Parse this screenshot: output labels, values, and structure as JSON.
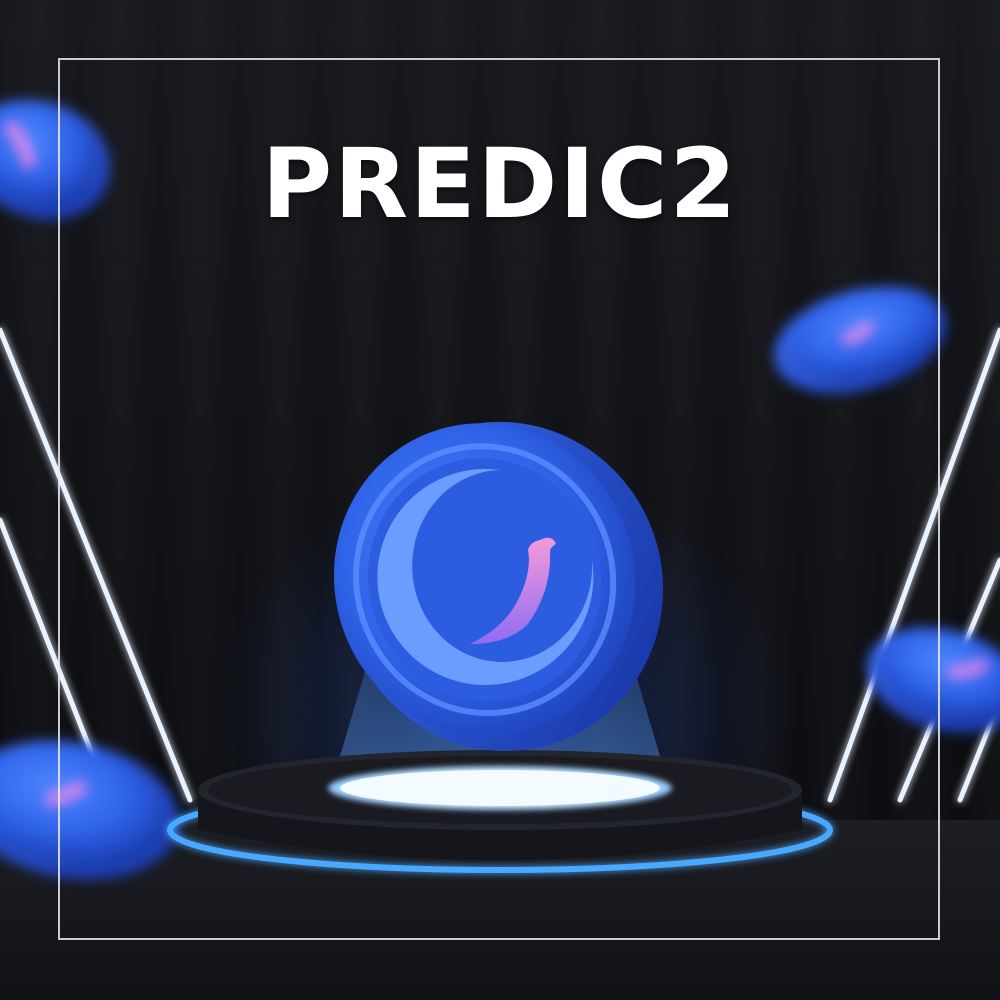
{
  "brand": {
    "name": "PREDIC2"
  },
  "colors": {
    "coin_blue": "#2f63e8",
    "coin_dark": "#1d3fb8",
    "coin_light": "#5b8cff",
    "logo_pink": "#e58ae6",
    "logo_violet": "#9b6bf2",
    "glow": "#4aa8ff",
    "background": "#0f1014",
    "frame": "#ebebf0"
  },
  "icons": [
    "coin-logo-icon"
  ]
}
